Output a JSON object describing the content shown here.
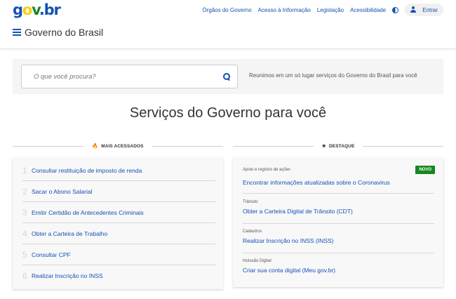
{
  "logo": {
    "g": "g",
    "o": "o",
    "v": "v",
    "dot": ".",
    "b": "b",
    "r": "r"
  },
  "header": {
    "links": [
      "Órgãos do Governo",
      "Acesso à Informação",
      "Legislação",
      "Acessibilidade"
    ],
    "contrast_icon": "contrast-icon",
    "login_label": "Entrar",
    "login_icon": "user-icon",
    "menu_icon": "hamburger-menu-icon",
    "site_title": "Governo do Brasil"
  },
  "search": {
    "placeholder": "O que você procura?",
    "icon": "search-icon",
    "description": "Reunimos em um só lugar serviços do Governo do Brasil para você"
  },
  "main_title": "Serviços do Governo para você",
  "mais_acessados": {
    "title": "MAIS ACESSADOS",
    "icon": "fire-icon",
    "items": [
      {
        "num": "1",
        "label": "Consultar restituição de imposto de renda"
      },
      {
        "num": "2",
        "label": "Sacar o Abono Salarial"
      },
      {
        "num": "3",
        "label": "Emitir Certidão de Antecedentes Criminais"
      },
      {
        "num": "4",
        "label": "Obter a Carteira de Trabalho"
      },
      {
        "num": "5",
        "label": "Consultar CPF"
      },
      {
        "num": "6",
        "label": "Realizar Inscrição no INSS"
      }
    ]
  },
  "destaque": {
    "title": "DESTAQUE",
    "icon": "star-icon",
    "badge": "NOVO",
    "items": [
      {
        "category": "Apoio e registro de ações",
        "label": "Encontrar informações atualizadas sobre o Coronavirus"
      },
      {
        "category": "Trânsito",
        "label": "Obter a Carteira Digital de Trânsito (CDT)"
      },
      {
        "category": "Cadastros",
        "label": "Realizar Inscrição no INSS (INSS)"
      },
      {
        "category": "Inclusão Digital",
        "label": "Criar sua conta digital (Meu gov.br)"
      }
    ]
  },
  "colors": {
    "primary": "#1351b4",
    "green": "#168821",
    "yellow": "#ffcd07"
  }
}
